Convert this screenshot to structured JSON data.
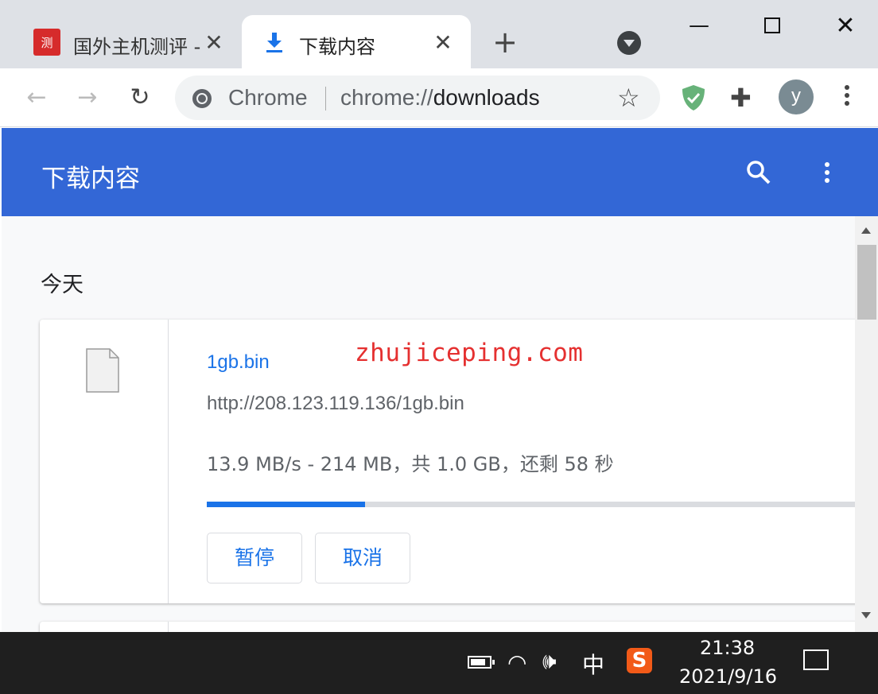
{
  "tabs": [
    {
      "title": "国外主机测评 - ",
      "favicon": "site-favicon",
      "favicon_text": "测"
    },
    {
      "title": "下载内容",
      "favicon": "download-icon"
    }
  ],
  "toolbar": {
    "origin": "Chrome",
    "url_prefix": "chrome://",
    "url_host": "downloads",
    "avatar_letter": "y"
  },
  "header": {
    "title": "下载内容"
  },
  "section": {
    "date": "今天"
  },
  "download": {
    "file_name": "1gb.bin",
    "watermark": "zhujiceping.com",
    "url": "http://208.123.119.136/1gb.bin",
    "status": "13.9 MB/s - 214 MB，共 1.0 GB，还剩 58 秒",
    "progress_percent": 24,
    "pause_label": "暂停",
    "cancel_label": "取消"
  },
  "taskbar": {
    "ime": "中",
    "time": "21:38",
    "date": "2021/9/16"
  },
  "colors": {
    "header_blue": "#3367d6",
    "link_blue": "#1a73e8",
    "watermark_red": "#e53030"
  }
}
